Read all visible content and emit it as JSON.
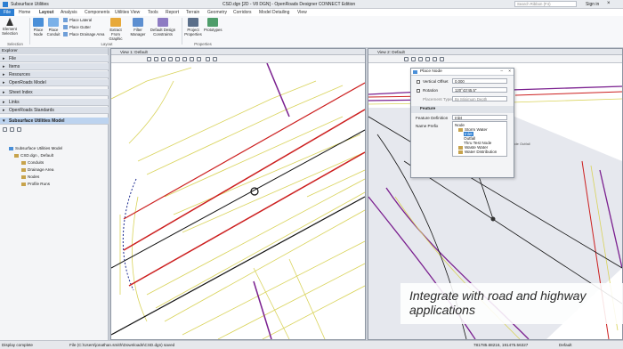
{
  "title_bar": {
    "workflow": "Subsurface Utilities",
    "title": "CSD.dgn [2D - V8 DGN] - OpenRoads Designer CONNECT Edition",
    "search_placeholder": "Search Ribbon (F4)",
    "sign_in": "Sign in"
  },
  "menu": [
    "File",
    "Home",
    "Layout",
    "Analysis",
    "Components",
    "Utilities View",
    "Tools",
    "Report",
    "Terrain",
    "Geometry",
    "Corridors",
    "Model Detailing",
    "View"
  ],
  "ribbon": {
    "element_selection": "Element Selection",
    "place_node": "Place Node",
    "place_conduit": "Place Conduit",
    "place_lateral": "Place Lateral",
    "place_gutter": "Place Gutter",
    "place_drainage_area": "Place Drainage Area",
    "extract_graphic": "Extract From Graphic",
    "filter_manager": "Filter Manager",
    "default_constraints": "Default Design Constraints",
    "project_properties": "Project Properties",
    "prototypes": "Prototypes",
    "group_selection": "Selection",
    "group_layout": "Layout",
    "group_properties": "Properties"
  },
  "explorer": {
    "header": "Explorer",
    "sections": [
      "File",
      "Items",
      "Resources",
      "OpenRoads Model",
      "Sheet Index",
      "Links",
      "OpenRoads Standards",
      "Subsurface Utilities Model"
    ],
    "tree": [
      {
        "label": "Subsurface Utilities Model",
        "indent": 0
      },
      {
        "label": "CSD.dgn , Default",
        "indent": 1
      },
      {
        "label": "Conduits",
        "indent": 2
      },
      {
        "label": "Drainage Area",
        "indent": 2
      },
      {
        "label": "Nodes",
        "indent": 2
      },
      {
        "label": "Profile Runs",
        "indent": 2
      }
    ]
  },
  "view1": {
    "title": "View 1: Default"
  },
  "view2": {
    "title": "View 2: Default"
  },
  "dialog": {
    "title": "Place Node",
    "vertical_offset_label": "Vertical Offset",
    "vertical_offset_value": "0.000",
    "rotation_label": "Rotation",
    "rotation_value": "120°43'45.5\"",
    "placement_type_label": "Placement Type",
    "placement_type_value": "By Minimum Depth",
    "feature_tab": "Feature",
    "feature_def_label": "Feature Definition",
    "feature_def_value": "Inlet",
    "name_prefix_label": "Name Prefix",
    "tree": [
      "Node",
      "Storm Water",
      "Inlet",
      "Outfall",
      "Thru Test Node",
      "Waste Water",
      "Water Distribution"
    ]
  },
  "drawing_note": "Thru Node Outfall",
  "caption": {
    "line1": "Integrate with road and highway",
    "line2": "applications"
  },
  "status": {
    "left": "Display complete",
    "file": "File (C:\\Users\\jonathan.smith\\Downloads\\CSD.dgn) saved",
    "coords": "781785.68216, 191475.56327",
    "model": "Default"
  },
  "colors": {
    "red": "#cc1f1f",
    "yellow": "#d9d35a",
    "purple": "#7a1f8f",
    "black": "#111111",
    "accent": "#2d7fd2"
  }
}
